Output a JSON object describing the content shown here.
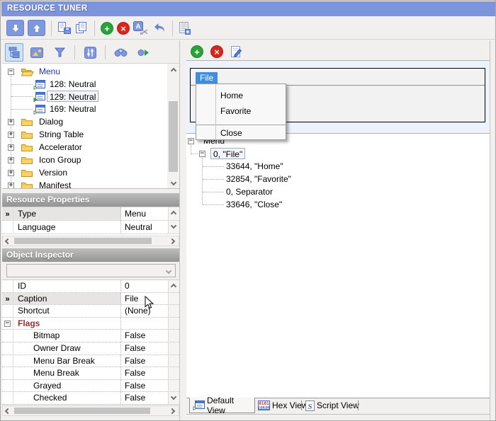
{
  "window": {
    "title": "RESOURCE TUNER"
  },
  "colors": {
    "titlebar_blue": "#7b94db",
    "toolbar_icon_blue": "#7e97dd",
    "add_green": "#27a338",
    "delete_red": "#da251c",
    "menu_highlight_blue": "#3f8edd",
    "flags_label_red": "#9b2f2f",
    "section_header_gray": "#a5a5a5",
    "tree_root_blue": "#2233aa"
  },
  "glyphs": {
    "marker": "»",
    "plus": "+",
    "minus": "−",
    "cross": "×",
    "rename_letter": "A",
    "hex_bits": "0101",
    "script_letter": "S"
  },
  "left_panel": {
    "tree": {
      "root": {
        "label": "Menu"
      },
      "menu_children": [
        {
          "label": "128: Neutral",
          "selected": false
        },
        {
          "label": "129: Neutral",
          "selected": true
        },
        {
          "label": "169: Neutral",
          "selected": false
        }
      ],
      "folders": [
        {
          "label": "Dialog"
        },
        {
          "label": "String Table"
        },
        {
          "label": "Accelerator"
        },
        {
          "label": "Icon Group"
        },
        {
          "label": "Version"
        },
        {
          "label": "Manifest"
        }
      ]
    },
    "resource_properties": {
      "title": "Resource Properties",
      "rows": [
        {
          "name": "Type",
          "value": "Menu",
          "selected": true
        },
        {
          "name": "Language",
          "value": "Neutral",
          "selected": false
        }
      ]
    },
    "object_inspector": {
      "title": "Object Inspector",
      "combo_value": "",
      "rows": [
        {
          "name": "ID",
          "value": "0"
        },
        {
          "name": "Caption",
          "value": "File",
          "selected": true
        },
        {
          "name": "Shortcut",
          "value": "(None)"
        },
        {
          "name": "Flags",
          "value": "",
          "group": true
        },
        {
          "name": "Bitmap",
          "value": "False"
        },
        {
          "name": "Owner Draw",
          "value": "False"
        },
        {
          "name": "Menu Bar Break",
          "value": "False"
        },
        {
          "name": "Menu Break",
          "value": "False"
        },
        {
          "name": "Grayed",
          "value": "False"
        },
        {
          "name": "Checked",
          "value": "False"
        }
      ]
    }
  },
  "right_panel": {
    "menu_preview": {
      "menubar_item": "File",
      "dropdown": {
        "items": [
          "Home",
          "Favorite",
          "Close"
        ],
        "separator_before_index": 2
      }
    },
    "resource_tree": {
      "root": "Menu",
      "popup": "0, \"File\"",
      "items": [
        "33644, \"Home\"",
        "32854, \"Favorite\"",
        "0, Separator",
        "33646, \"Close\""
      ]
    },
    "view_tabs": [
      {
        "label": "Default View",
        "active": true
      },
      {
        "label": "Hex View",
        "active": false
      },
      {
        "label": "Script View",
        "active": false
      }
    ]
  }
}
